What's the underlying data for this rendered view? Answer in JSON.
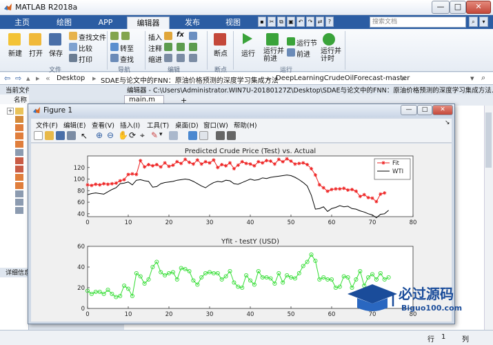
{
  "app": {
    "title": "MATLAB R2018a"
  },
  "window_buttons": [
    "—",
    "□",
    "✕"
  ],
  "ribbon_tabs": [
    {
      "label": "主页"
    },
    {
      "label": "绘图"
    },
    {
      "label": "APP"
    },
    {
      "label": "编辑器"
    },
    {
      "label": "发布"
    },
    {
      "label": "视图"
    }
  ],
  "search": {
    "placeholder": "搜索文档"
  },
  "ribbon": {
    "file": {
      "new": "新建",
      "open": "打开",
      "save": "保存",
      "find_files": "查找文件",
      "compare": "比较",
      "print": "打印",
      "group": "文件"
    },
    "navigate": {
      "goto": "转至",
      "find": "查找",
      "group": "导航"
    },
    "edit": {
      "insert": "插入",
      "comment": "注释",
      "indent": "缩进",
      "fx": "fx",
      "group": "编辑"
    },
    "breakpoints": {
      "breakpoints": "断点",
      "group": "断点"
    },
    "run": {
      "run": "运行",
      "run_advance": "运行并\n前进",
      "run_section": "运行节",
      "advance": "前进",
      "run_time": "运行并\n计时",
      "group": "运行"
    }
  },
  "addressbar": {
    "path": [
      "Desktop",
      "SDAE与论文中的FNN：原油价格预测的深度学习集成方法",
      "DeepLearningCrudeOilForecast-master"
    ]
  },
  "current_folder": {
    "title": "当前文件夹",
    "name_header": "名称",
    "details_title": "详细信息"
  },
  "editor": {
    "title": "编辑器 - C:\\Users\\Administrator.WIN7U-20180127Z\\Desktop\\SDAE与论文中的FNN：原油价格预测的深度学习集成方法...",
    "tab": "main.m",
    "add_tab": "+"
  },
  "statusbar": {
    "row_label": "行",
    "row_value": "1",
    "col_label": "列"
  },
  "figure": {
    "title": "Figure 1",
    "menu": [
      "文件(F)",
      "编辑(E)",
      "查看(V)",
      "插入(I)",
      "工具(T)",
      "桌面(D)",
      "窗口(W)",
      "帮助(H)"
    ]
  },
  "watermark": {
    "text": "必过源码",
    "url": "Biguo100.com"
  },
  "chart_data": [
    {
      "type": "line",
      "title": "Predicted Crude Price (Test) vs. Actual",
      "xlim": [
        0,
        80
      ],
      "ylim": [
        35,
        140
      ],
      "xticks": [
        0,
        10,
        20,
        30,
        40,
        50,
        60,
        70,
        80
      ],
      "yticks": [
        40,
        60,
        80,
        100,
        120
      ],
      "grid": false,
      "legend_position": "top-right",
      "series": [
        {
          "name": "Fit",
          "color": "#ee2222",
          "marker": "star",
          "values": [
            90,
            89,
            91,
            90,
            92,
            91,
            92,
            93,
            97,
            99,
            108,
            109,
            108,
            132,
            121,
            125,
            123,
            125,
            121,
            128,
            122,
            124,
            130,
            127,
            134,
            129,
            126,
            133,
            126,
            130,
            128,
            133,
            120,
            125,
            123,
            128,
            118,
            124,
            130,
            127,
            126,
            123,
            130,
            128,
            132,
            131,
            126,
            134,
            130,
            135,
            131,
            126,
            127,
            128,
            125,
            118,
            107,
            90,
            85,
            79,
            82,
            83,
            83,
            84,
            81,
            82,
            79,
            70,
            73,
            68,
            67,
            61,
            74,
            76
          ]
        },
        {
          "name": "WTI",
          "color": "#000000",
          "marker": "none",
          "values": [
            73,
            75,
            76,
            75,
            74,
            78,
            82,
            85,
            92,
            93,
            95,
            90,
            98,
            99,
            97,
            96,
            86,
            87,
            92,
            94,
            95,
            96,
            98,
            99,
            100,
            99,
            96,
            92,
            88,
            85,
            90,
            94,
            96,
            95,
            98,
            97,
            92,
            91,
            94,
            97,
            100,
            98,
            99,
            102,
            101,
            103,
            104,
            105,
            106,
            107,
            106,
            103,
            99,
            94,
            88,
            72,
            48,
            49,
            52,
            44,
            49,
            51,
            54,
            52,
            53,
            49,
            48,
            45,
            43,
            40,
            38,
            33,
            39,
            40,
            46
          ]
        }
      ]
    },
    {
      "type": "line",
      "title": "Yfit - testY (USD)",
      "xlim": [
        0,
        80
      ],
      "ylim": [
        0,
        60
      ],
      "xticks": [
        0,
        10,
        20,
        30,
        40,
        50,
        60,
        70,
        80
      ],
      "yticks": [
        0,
        20,
        40,
        60
      ],
      "grid": false,
      "series": [
        {
          "color": "#33dd33",
          "marker": "circle",
          "values": [
            17,
            14,
            16,
            16,
            14,
            18,
            14,
            11,
            12,
            22,
            19,
            12,
            34,
            31,
            24,
            28,
            40,
            45,
            35,
            32,
            34,
            35,
            28,
            39,
            38,
            36,
            27,
            23,
            30,
            34,
            35,
            34,
            34,
            28,
            31,
            36,
            25,
            21,
            20,
            32,
            27,
            23,
            36,
            30,
            30,
            29,
            24,
            34,
            25,
            32,
            30,
            29,
            34,
            41,
            45,
            52,
            46,
            28,
            30,
            28,
            28,
            20,
            21,
            31,
            30,
            20,
            28,
            36,
            22,
            30,
            33,
            28,
            34,
            28,
            30
          ]
        }
      ]
    }
  ]
}
